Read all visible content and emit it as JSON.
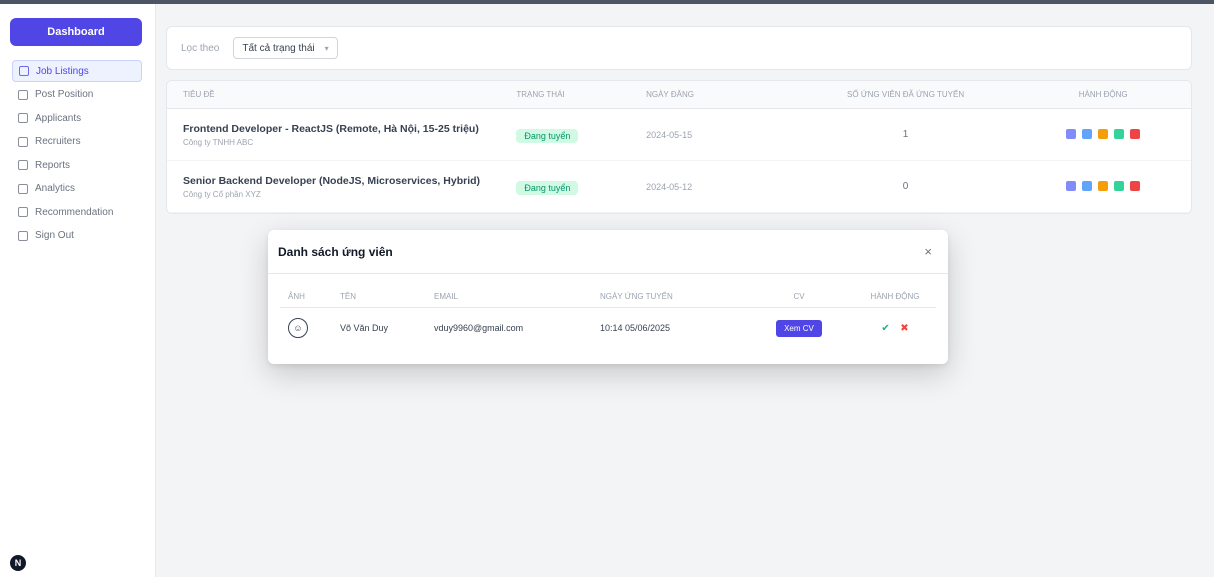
{
  "sidebar": {
    "brand_label": "Dashboard",
    "items": [
      {
        "label": "Job Listings",
        "active": true
      },
      {
        "label": "Post Position",
        "active": false
      },
      {
        "label": "Applicants",
        "active": false
      },
      {
        "label": "Recruiters",
        "active": false
      },
      {
        "label": "Reports",
        "active": false
      },
      {
        "label": "Analytics",
        "active": false
      },
      {
        "label": "Recommendation",
        "active": false
      },
      {
        "label": "Sign Out",
        "active": false
      }
    ],
    "help_label": "N"
  },
  "filter": {
    "label": "Lọc theo",
    "select_value": "Tất cả trạng thái"
  },
  "jobs_table": {
    "headers": [
      "Tiêu đề",
      "Trạng thái",
      "Ngày đăng",
      "Số ứng viên đã ứng tuyển",
      "Hành động"
    ],
    "rows": [
      {
        "title": "Frontend Developer - ReactJS (Remote, Hà Nội, 15-25 triệu)",
        "subtitle": "Công ty TNHH ABC",
        "status": "Đang tuyển",
        "date": "2024-05-15",
        "count": "1"
      },
      {
        "title": "Senior Backend Developer (NodeJS, Microservices, Hybrid)",
        "subtitle": "Công ty Cổ phần XYZ",
        "status": "Đang tuyển",
        "date": "2024-05-12",
        "count": "0"
      }
    ]
  },
  "colors": {
    "accent": "#4f46e5",
    "status_green": "#059669",
    "action_colors": [
      "#818cf8",
      "#60a5fa",
      "#f59e0b",
      "#34d399",
      "#ef4444"
    ]
  },
  "modal": {
    "title": "Danh sách ứng viên",
    "close_icon": "×",
    "headers": [
      "Ảnh",
      "Tên",
      "Email",
      "Ngày ứng tuyển",
      "CV",
      "Hành động"
    ],
    "rows": [
      {
        "avatar_icon": "user-circle-icon",
        "name": "Võ Văn Duy",
        "email": "vduy9960@gmail.com",
        "applied_at": "10:14 05/06/2025",
        "cv_label": "Xem CV"
      }
    ]
  }
}
